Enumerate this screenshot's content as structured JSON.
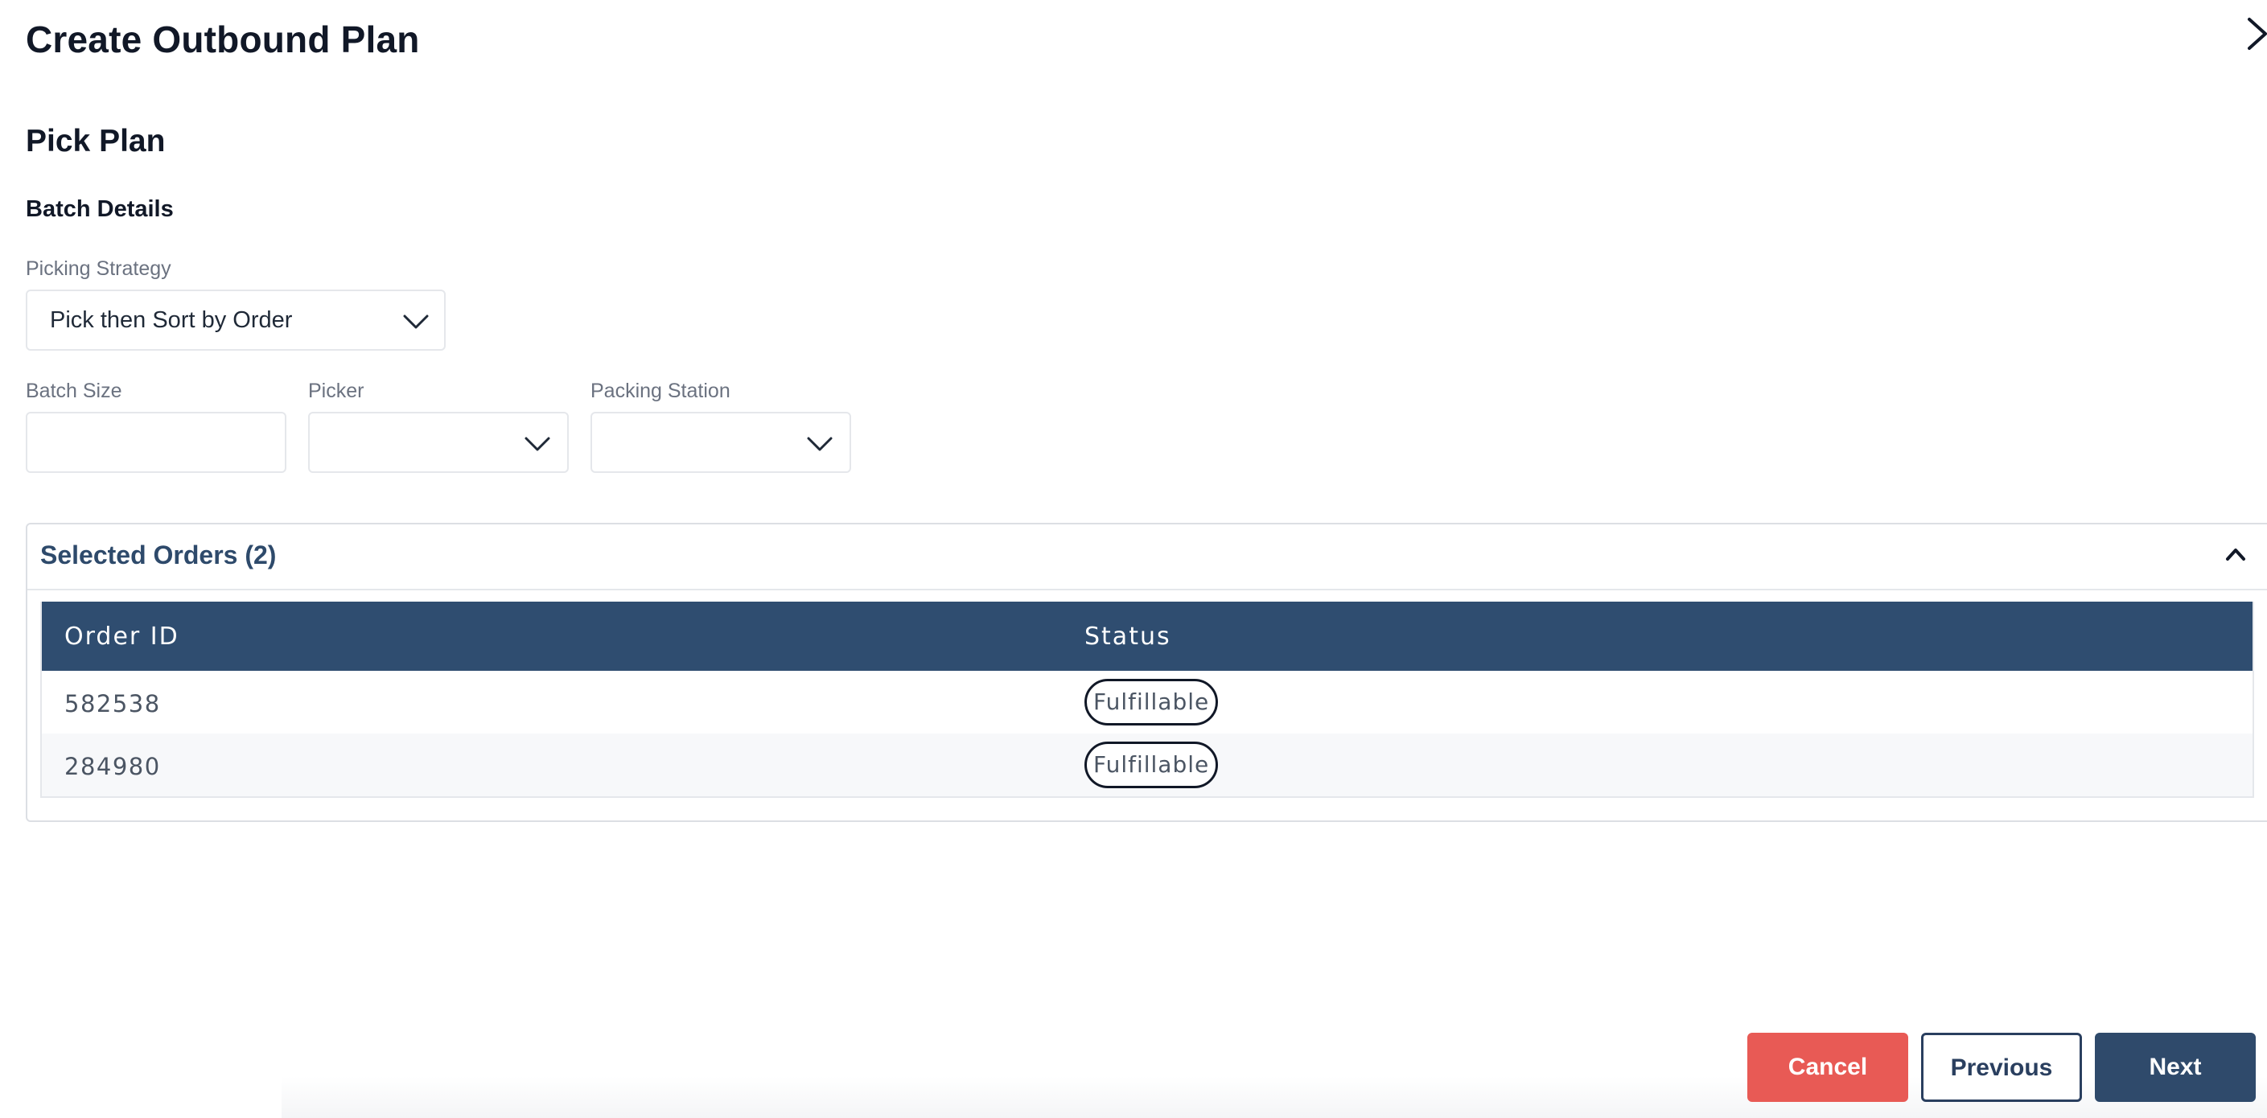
{
  "modal": {
    "title": "Create Outbound Plan"
  },
  "pick_plan": {
    "section_title": "Pick Plan",
    "batch_details_title": "Batch Details",
    "picking_strategy": {
      "label": "Picking Strategy",
      "value": "Pick then Sort by Order"
    },
    "batch_size": {
      "label": "Batch Size",
      "value": ""
    },
    "picker": {
      "label": "Picker",
      "value": ""
    },
    "packing_station": {
      "label": "Packing Station",
      "value": ""
    }
  },
  "selected_orders": {
    "title": "Selected Orders (2)",
    "columns": [
      "Order ID",
      "Status"
    ],
    "rows": [
      {
        "order_id": "582538",
        "status": "Fulfillable"
      },
      {
        "order_id": "284980",
        "status": "Fulfillable"
      }
    ]
  },
  "footer": {
    "cancel_label": "Cancel",
    "previous_label": "Previous",
    "next_label": "Next"
  },
  "icons": {
    "close": "close-icon",
    "dropdown": "chevron-down-icon",
    "collapse": "chevron-up-icon"
  },
  "colors": {
    "primary": "#2f4a6b",
    "danger": "#e85a55",
    "table_header": "#2f4d70",
    "section_title": "#2e4a6b"
  }
}
